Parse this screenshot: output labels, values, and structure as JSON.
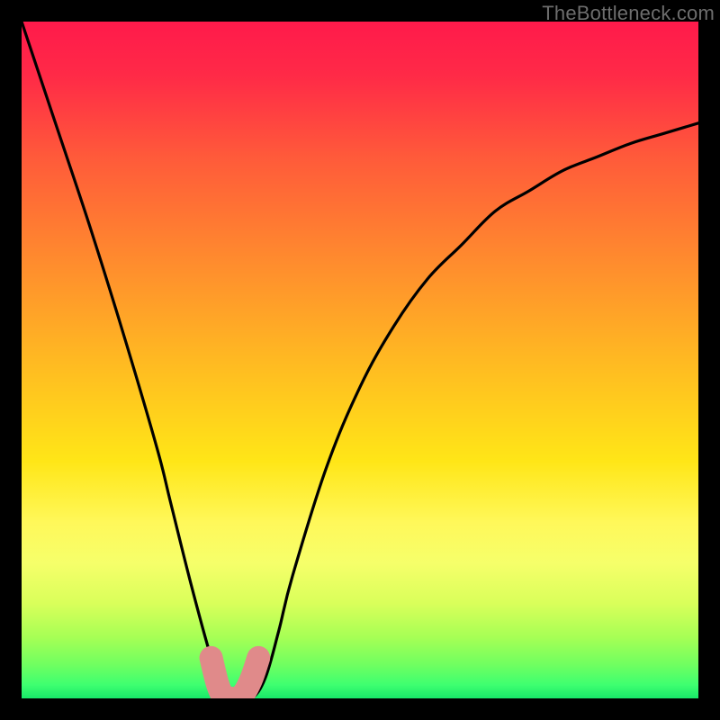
{
  "watermark": "TheBottleneck.com",
  "chart_data": {
    "type": "line",
    "title": "",
    "xlabel": "",
    "ylabel": "",
    "xlim": [
      0,
      100
    ],
    "ylim": [
      0,
      100
    ],
    "grid": false,
    "series": [
      {
        "name": "bottleneck-curve",
        "x": [
          0,
          5,
          10,
          15,
          20,
          22,
          25,
          28,
          30,
          32,
          34,
          36,
          38,
          40,
          45,
          50,
          55,
          60,
          65,
          70,
          75,
          80,
          85,
          90,
          95,
          100
        ],
        "y": [
          100,
          85,
          70,
          54,
          37,
          29,
          17,
          6,
          0,
          0,
          0,
          3,
          10,
          18,
          34,
          46,
          55,
          62,
          67,
          72,
          75,
          78,
          80,
          82,
          83.5,
          85
        ]
      }
    ],
    "highlight_segment": {
      "name": "optimal-range",
      "x": [
        28,
        29,
        30,
        31,
        32,
        33,
        34,
        35
      ],
      "y": [
        6,
        2,
        0,
        0,
        0,
        1,
        3,
        6
      ]
    },
    "background_gradient": {
      "stops": [
        {
          "offset": 0.0,
          "color": "#ff1a4b"
        },
        {
          "offset": 0.08,
          "color": "#ff2a47"
        },
        {
          "offset": 0.2,
          "color": "#ff5a3a"
        },
        {
          "offset": 0.35,
          "color": "#ff8a2e"
        },
        {
          "offset": 0.5,
          "color": "#ffb922"
        },
        {
          "offset": 0.65,
          "color": "#ffe617"
        },
        {
          "offset": 0.74,
          "color": "#fff85a"
        },
        {
          "offset": 0.8,
          "color": "#f6ff6a"
        },
        {
          "offset": 0.86,
          "color": "#d9ff5a"
        },
        {
          "offset": 0.91,
          "color": "#a6ff55"
        },
        {
          "offset": 0.95,
          "color": "#70ff60"
        },
        {
          "offset": 0.98,
          "color": "#3eff70"
        },
        {
          "offset": 1.0,
          "color": "#18e869"
        }
      ]
    }
  }
}
